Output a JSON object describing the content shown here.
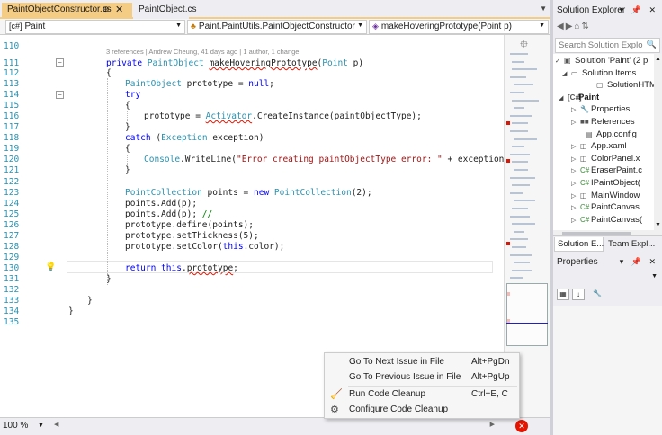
{
  "tabs": [
    {
      "label": "PaintObjectConstructor.cs",
      "pin": "⊕",
      "close": "✕"
    },
    {
      "label": "PaintObject.cs"
    }
  ],
  "navbar": {
    "project": "Paint",
    "class": "Paint.PaintUtils.PaintObjectConstructor",
    "member": "makeHoveringPrototype(Point p)"
  },
  "editor": {
    "codelens": "3 references | Andrew Cheung, 41 days ago | 1 author, 1 change",
    "line_numbers": [
      "110",
      "111",
      "112",
      "113",
      "114",
      "115",
      "116",
      "117",
      "118",
      "119",
      "120",
      "121",
      "122",
      "123",
      "124",
      "125",
      "126",
      "127",
      "128",
      "129",
      "130",
      "131",
      "132",
      "133",
      "134",
      "135"
    ],
    "zoom": "100 %"
  },
  "context_menu": {
    "items": [
      {
        "label": "Go To Next Issue in File",
        "shortcut": "Alt+PgDn",
        "icon": ""
      },
      {
        "label": "Go To Previous Issue in File",
        "shortcut": "Alt+PgUp",
        "icon": ""
      },
      {
        "label": "Run Code Cleanup",
        "shortcut": "Ctrl+E, C",
        "icon": "broom-icon"
      },
      {
        "label": "Configure Code Cleanup",
        "shortcut": "",
        "icon": "gear-icon"
      }
    ]
  },
  "solution_explorer": {
    "title": "Solution Explorer",
    "search_placeholder": "Search Solution Explo",
    "items": [
      {
        "label": "Solution 'Paint' (2 p",
        "icon": "solution-icon"
      },
      {
        "label": "Solution Items",
        "icon": "folder-icon"
      },
      {
        "label": "SolutionHTM",
        "icon": "file-icon"
      },
      {
        "label": "Paint",
        "icon": "csharp-project-icon"
      },
      {
        "label": "Properties",
        "icon": "wrench-icon"
      },
      {
        "label": "References",
        "icon": "references-icon"
      },
      {
        "label": "App.config",
        "icon": "config-icon"
      },
      {
        "label": "App.xaml",
        "icon": "xaml-icon"
      },
      {
        "label": "ColorPanel.x",
        "icon": "xaml-icon"
      },
      {
        "label": "EraserPaint.c",
        "icon": "csharp-file-icon"
      },
      {
        "label": "IPaintObject(",
        "icon": "csharp-file-icon"
      },
      {
        "label": "MainWindow",
        "icon": "xaml-icon"
      },
      {
        "label": "PaintCanvas.",
        "icon": "csharp-file-icon"
      },
      {
        "label": "PaintCanvas(",
        "icon": "csharp-file-icon"
      }
    ],
    "bottom_tabs": [
      "Solution E...",
      "Team Expl..."
    ]
  },
  "properties": {
    "title": "Properties"
  },
  "colors": {
    "active_tab": "#f5cc84",
    "keyword": "#0000ff",
    "type": "#2b91af",
    "string": "#a31515",
    "comment": "#008000",
    "error": "#e51400"
  }
}
